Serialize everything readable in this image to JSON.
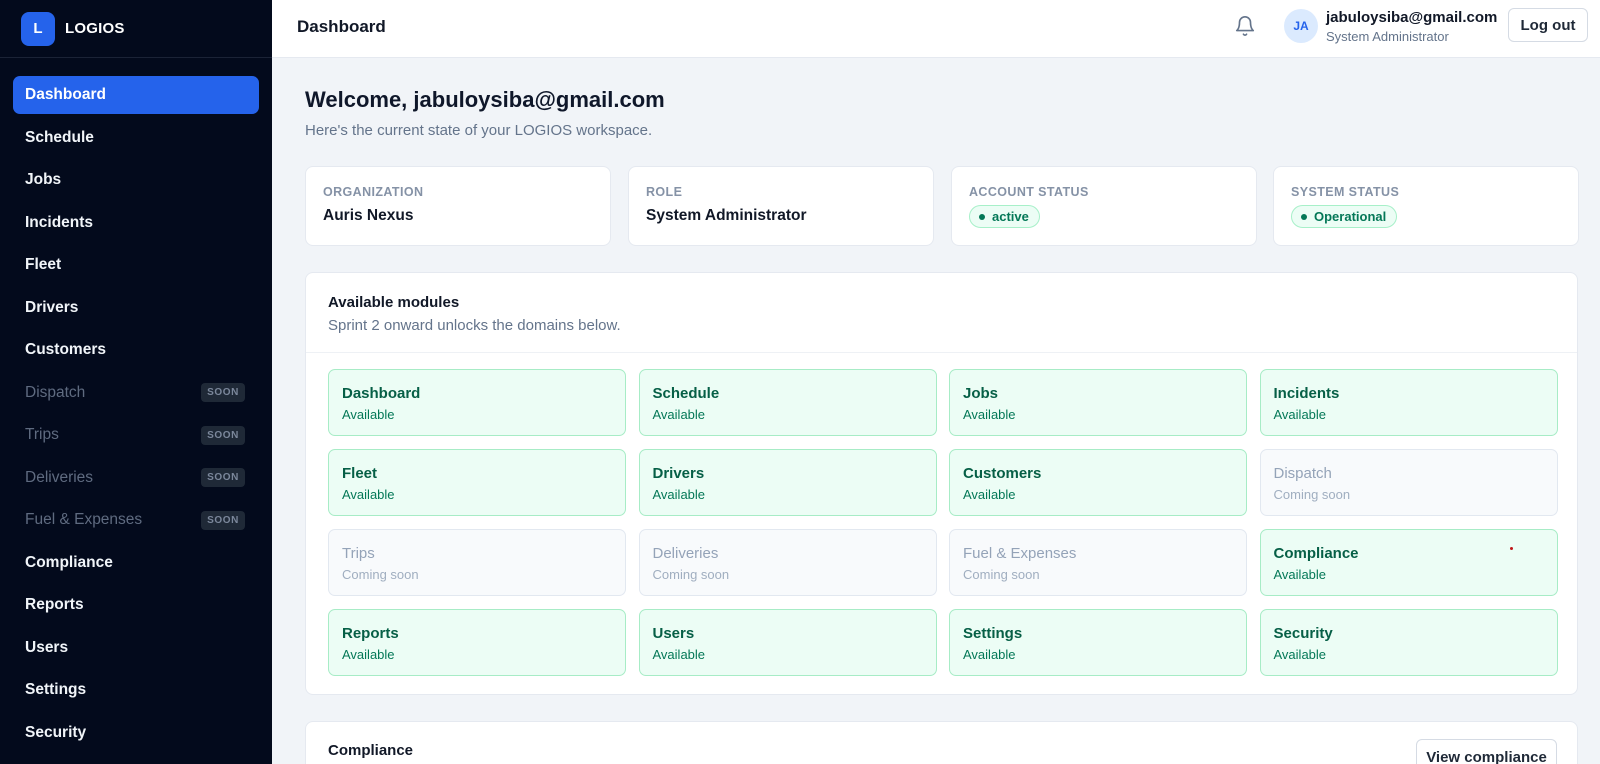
{
  "brand": {
    "logo_letter": "L",
    "name": "LOGIOS"
  },
  "sidebar": {
    "items": [
      {
        "label": "Dashboard",
        "state": "active"
      },
      {
        "label": "Schedule",
        "state": "enabled"
      },
      {
        "label": "Jobs",
        "state": "enabled"
      },
      {
        "label": "Incidents",
        "state": "enabled"
      },
      {
        "label": "Fleet",
        "state": "enabled"
      },
      {
        "label": "Drivers",
        "state": "enabled"
      },
      {
        "label": "Customers",
        "state": "enabled"
      },
      {
        "label": "Dispatch",
        "state": "disabled",
        "badge": "SOON"
      },
      {
        "label": "Trips",
        "state": "disabled",
        "badge": "SOON"
      },
      {
        "label": "Deliveries",
        "state": "disabled",
        "badge": "SOON"
      },
      {
        "label": "Fuel & Expenses",
        "state": "disabled",
        "badge": "SOON"
      },
      {
        "label": "Compliance",
        "state": "enabled"
      },
      {
        "label": "Reports",
        "state": "enabled"
      },
      {
        "label": "Users",
        "state": "enabled"
      },
      {
        "label": "Settings",
        "state": "enabled"
      },
      {
        "label": "Security",
        "state": "enabled"
      }
    ]
  },
  "header": {
    "title": "Dashboard",
    "notification_icon": "bell-icon",
    "user": {
      "initials": "JA",
      "email": "jabuloysiba@gmail.com",
      "role": "System Administrator"
    },
    "logout_label": "Log out"
  },
  "welcome": {
    "title": "Welcome, jabuloysiba@gmail.com",
    "subtitle": "Here's the current state of your LOGIOS workspace."
  },
  "stats": [
    {
      "label": "ORGANIZATION",
      "value": "Auris Nexus",
      "kind": "text"
    },
    {
      "label": "ROLE",
      "value": "System Administrator",
      "kind": "text"
    },
    {
      "label": "ACCOUNT STATUS",
      "value": "active",
      "kind": "pill"
    },
    {
      "label": "SYSTEM STATUS",
      "value": "Operational",
      "kind": "pill"
    }
  ],
  "modules_panel": {
    "title": "Available modules",
    "subtitle": "Sprint 2 onward unlocks the domains below.",
    "modules": [
      {
        "name": "Dashboard",
        "status": "Available"
      },
      {
        "name": "Schedule",
        "status": "Available"
      },
      {
        "name": "Jobs",
        "status": "Available"
      },
      {
        "name": "Incidents",
        "status": "Available"
      },
      {
        "name": "Fleet",
        "status": "Available"
      },
      {
        "name": "Drivers",
        "status": "Available"
      },
      {
        "name": "Customers",
        "status": "Available"
      },
      {
        "name": "Dispatch",
        "status": "Coming soon"
      },
      {
        "name": "Trips",
        "status": "Coming soon"
      },
      {
        "name": "Deliveries",
        "status": "Coming soon"
      },
      {
        "name": "Fuel & Expenses",
        "status": "Coming soon"
      },
      {
        "name": "Compliance",
        "status": "Available"
      },
      {
        "name": "Reports",
        "status": "Available"
      },
      {
        "name": "Users",
        "status": "Available"
      },
      {
        "name": "Settings",
        "status": "Available"
      },
      {
        "name": "Security",
        "status": "Available"
      }
    ]
  },
  "compliance_panel": {
    "title": "Compliance",
    "button_label": "View compliance"
  },
  "colors": {
    "sidebar_bg": "#030a1c",
    "accent": "#2563eb",
    "available_bg": "#ecfdf5",
    "available_text": "#065f46",
    "page_bg": "#f1f4f8"
  }
}
